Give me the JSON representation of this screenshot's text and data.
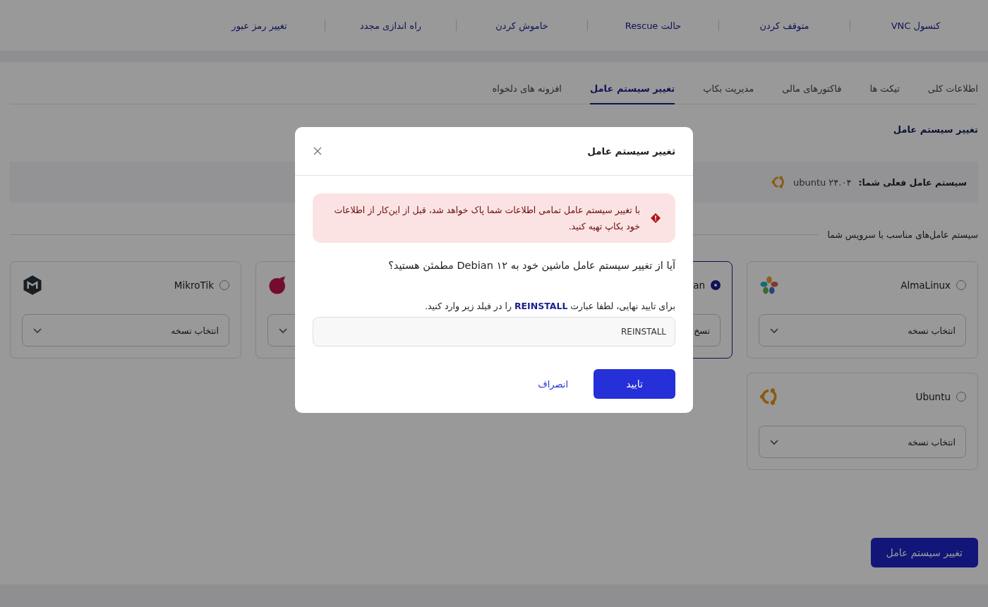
{
  "actions": [
    {
      "label": "کنسول VNC"
    },
    {
      "label": "متوقف کردن"
    },
    {
      "label": "حالت Rescue"
    },
    {
      "label": "خاموش کردن"
    },
    {
      "label": "راه اندازی مجدد"
    },
    {
      "label": "تغییر رمز عبور"
    }
  ],
  "tabs": [
    {
      "label": "اطلاعات کلی",
      "selected": false
    },
    {
      "label": "تیکت ها",
      "selected": false
    },
    {
      "label": "فاکتورهای مالی",
      "selected": false
    },
    {
      "label": "مدیریت بکاپ",
      "selected": false
    },
    {
      "label": "تغییر سیستم عامل",
      "selected": true
    },
    {
      "label": "افزونه های دلخواه",
      "selected": false
    }
  ],
  "section_title": "تغییر سیستم عامل",
  "current_os": {
    "label": "سیستم عامل فعلی شما:",
    "kind": "ring",
    "value": "ubuntu ۲۴.۰۴"
  },
  "os_heading": "سیستم عامل‌های مناسب با سرویس شما",
  "os_cards": [
    {
      "name": "AlmaLinux",
      "kind": "petals",
      "selected": false,
      "version_placeholder": "انتخاب نسخه"
    },
    {
      "name": "an",
      "kind": "none",
      "selected": true,
      "version_placeholder": "نسخ"
    },
    {
      "kind": "round"
    },
    {
      "name": "MikroTik",
      "kind": "hexagon",
      "selected": false,
      "version_placeholder": "انتخاب نسخه"
    },
    {
      "name": "Ubuntu",
      "kind": "ring",
      "selected": false,
      "version_placeholder": "انتخاب نسخه"
    }
  ],
  "submit_button": "تغییر سیستم عامل",
  "dialog": {
    "title": "تغییر سیستم عامل",
    "warning": "با تغییر سیستم عامل تمامی اطلاعات شما پاک خواهد شد، قبل از این‌کار از اطلاعات خود بکاپ تهیه کنید.",
    "question": "آیا از تغییر سیستم عامل ماشین خود به Debian ۱۲ مطمئن هستید؟",
    "confirm_label": "برای تایید نهایی، لطفا عبارت **REINSTALL** را در فیلد زیر وارد کنید.",
    "confirm_value": "REINSTALL",
    "ok_button": "تایید",
    "cancel_button": "انصراف"
  }
}
